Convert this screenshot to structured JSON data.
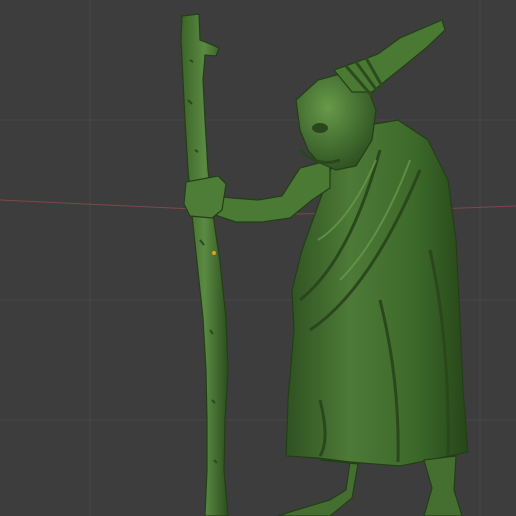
{
  "viewport": {
    "background": "#3d3d3d",
    "grid_color": "#484848",
    "x_axis_color": "#8a4a4a",
    "origin_color": "#e0a020",
    "shading": "solid",
    "model_color": "#3f6a2b",
    "model_highlight": "#5e8d44",
    "model_shadow": "#24401a",
    "icons": [
      "3d-viewport-icon",
      "hag-figure-icon",
      "wooden-staff-icon",
      "world-origin-icon"
    ]
  }
}
